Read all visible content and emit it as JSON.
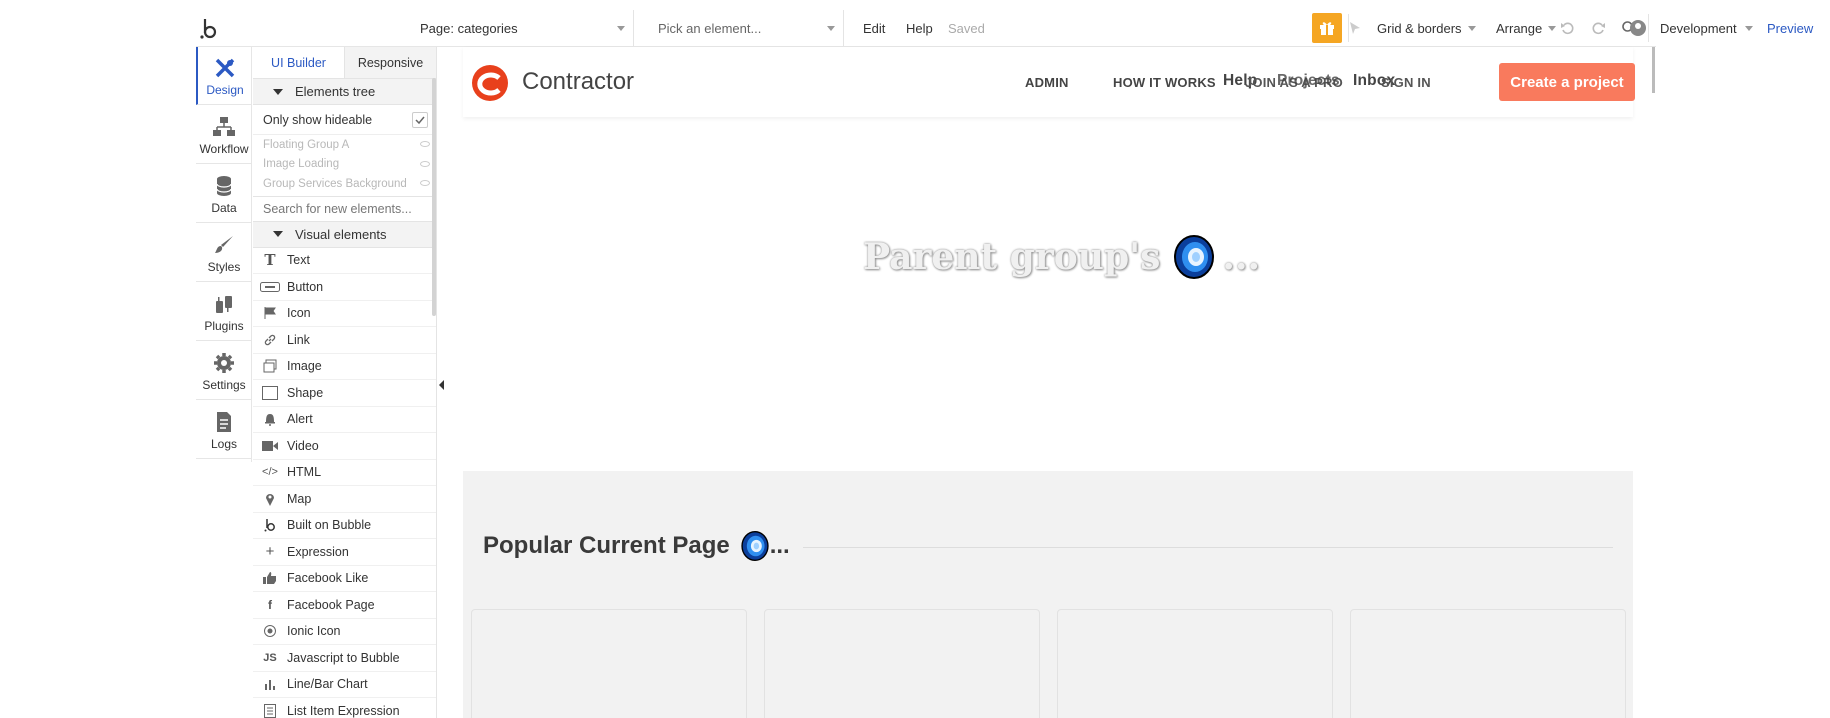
{
  "toolbar": {
    "page_label": "Page: categories",
    "element_placeholder": "Pick an element...",
    "edit": "Edit",
    "help": "Help",
    "saved": "Saved",
    "grid": "Grid & borders",
    "arrange": "Arrange",
    "env": "Development",
    "preview": "Preview"
  },
  "rail": {
    "design": "Design",
    "workflow": "Workflow",
    "data": "Data",
    "styles": "Styles",
    "plugins": "Plugins",
    "settings": "Settings",
    "logs": "Logs"
  },
  "panel": {
    "tab_ui": "UI Builder",
    "tab_responsive": "Responsive",
    "tree_header": "Elements tree",
    "only_hideable": "Only show hideable",
    "hidden_items": [
      "Floating Group A",
      "Image Loading",
      "Group Services Background"
    ],
    "search_placeholder": "Search for new elements...",
    "visual_header": "Visual elements",
    "items": [
      "Text",
      "Button",
      "Icon",
      "Link",
      "Image",
      "Shape",
      "Alert",
      "Video",
      "HTML",
      "Map",
      "Built on Bubble",
      "Expression",
      "Facebook Like",
      "Facebook Page",
      "Ionic Icon",
      "Javascript to Bubble",
      "Line/Bar Chart",
      "List Item Expression"
    ]
  },
  "canvas": {
    "brand": "Contractor",
    "nav": {
      "admin": "ADMIN",
      "how": "HOW IT WORKS",
      "help": "Help",
      "join": "JOIN AS A PRO",
      "projects": "Projects",
      "inbox": "Inbox",
      "signin": "SIGN IN"
    },
    "cta": "Create a project",
    "hero": "Parent group's",
    "hero_ellipsis": "...",
    "popular": "Popular Current Page",
    "popular_ellipsis": "..."
  },
  "colors": {
    "accent": "#2b59c3",
    "cta": "#f97a5d",
    "gift": "#f5a623",
    "brand_red": "#e8401c"
  }
}
